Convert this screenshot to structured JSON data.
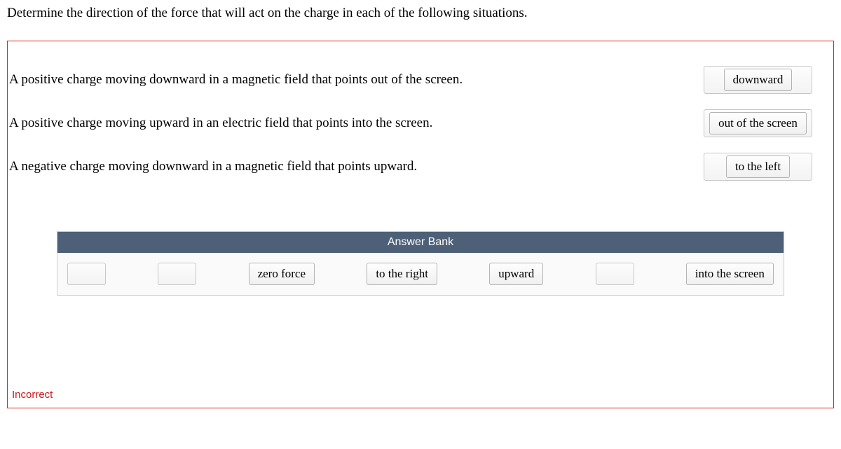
{
  "question": "Determine the direction of the force that will act on the charge in each of the following situations.",
  "rows": [
    {
      "text": "A positive charge moving downward in a magnetic field that points out of the screen.",
      "answer": "downward"
    },
    {
      "text": "A positive charge moving upward in an electric field that points into the screen.",
      "answer": "out of the screen"
    },
    {
      "text": "A negative charge moving downward in a magnetic field that points upward.",
      "answer": "to the left"
    }
  ],
  "answerBank": {
    "title": "Answer Bank",
    "items": [
      {
        "label": "",
        "empty": true
      },
      {
        "label": "",
        "empty": true
      },
      {
        "label": "zero force",
        "empty": false
      },
      {
        "label": "to the right",
        "empty": false
      },
      {
        "label": "upward",
        "empty": false
      },
      {
        "label": "",
        "empty": true
      },
      {
        "label": "into the screen",
        "empty": false
      }
    ]
  },
  "status": "Incorrect"
}
